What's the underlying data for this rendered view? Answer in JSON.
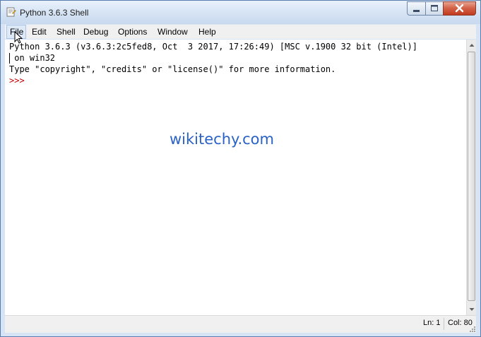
{
  "window": {
    "title": "Python 3.6.3 Shell",
    "close_color": "#c13a1d"
  },
  "menu": {
    "items": [
      {
        "label": "File"
      },
      {
        "label": "Edit"
      },
      {
        "label": "Shell"
      },
      {
        "label": "Debug"
      },
      {
        "label": "Options"
      },
      {
        "label": "Window"
      },
      {
        "label": "Help"
      }
    ]
  },
  "shell": {
    "banner_line1": "Python 3.6.3 (v3.6.3:2c5fed8, Oct  3 2017, 17:26:49) [MSC v.1900 32 bit (Intel)]",
    "banner_line2": " on win32",
    "banner_line3": "Type \"copyright\", \"credits\" or \"license()\" for more information.",
    "prompt": ">>>"
  },
  "watermark": "wikitechy.com",
  "status": {
    "line": "Ln: 1",
    "column": "Col: 80"
  },
  "icons": {
    "app": "python-idle-icon",
    "minimize": "minimize-icon",
    "maximize": "maximize-icon",
    "close": "close-icon",
    "cursor": "mouse-pointer-icon"
  }
}
